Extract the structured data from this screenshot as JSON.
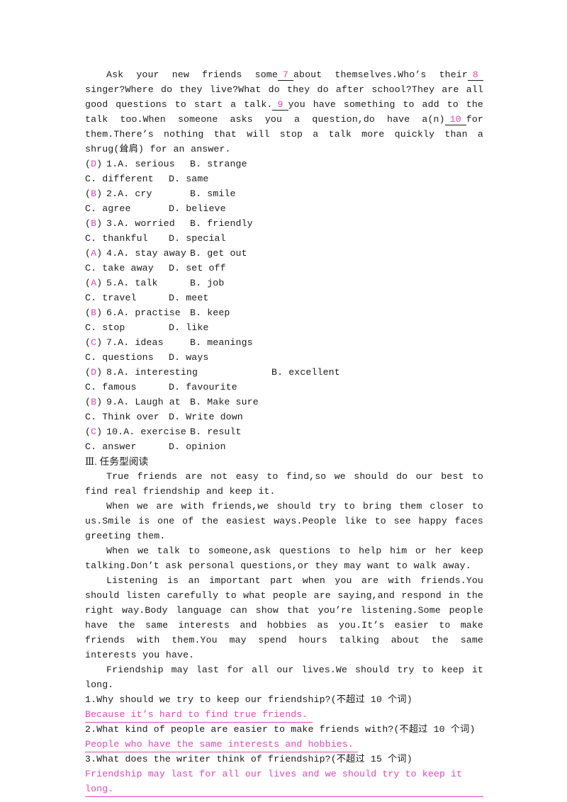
{
  "cloze": {
    "paragraph_parts": [
      "Ask your new friends some",
      "about themselves.Who’s their",
      "singer?Where do they live?What do they do after school?They are all good questions to start a talk.",
      "you have something to add to the talk too.When someone asks you a question,do have a(n)",
      "for them.There’s nothing that will stop a talk more quickly than a shrug(耸肩) for an answer."
    ],
    "blank_7": "7",
    "blank_8": "8",
    "blank_9": "9",
    "blank_10": "10"
  },
  "questions": [
    {
      "number": "1.",
      "answer": "D",
      "a": "A. serious",
      "b": "B. strange",
      "c": "C. different",
      "d": "D. same",
      "wide": false
    },
    {
      "number": "2.",
      "answer": "B",
      "a": "A. cry",
      "b": "B. smile",
      "c": "C. agree",
      "d": "D. believe",
      "wide": false
    },
    {
      "number": "3.",
      "answer": "B",
      "a": "A. worried",
      "b": "B. friendly",
      "c": "C. thankful",
      "d": "D. special",
      "wide": false
    },
    {
      "number": "4.",
      "answer": "A",
      "a": "A. stay away",
      "b": "B. get out",
      "c": "C. take away",
      "d": "D. set off",
      "wide": false
    },
    {
      "number": "5.",
      "answer": "A",
      "a": "A. talk",
      "b": "B. job",
      "c": "C. travel",
      "d": "D. meet",
      "wide": false
    },
    {
      "number": "6.",
      "answer": "B",
      "a": "A. practise",
      "b": "B. keep",
      "c": "C. stop",
      "d": "D. like",
      "wide": false
    },
    {
      "number": "7.",
      "answer": "C",
      "a": "A. ideas",
      "b": "B. meanings",
      "c": "C. questions",
      "d": "D. ways",
      "wide": false
    },
    {
      "number": "8.",
      "answer": "D",
      "a": "A. interesting",
      "b": "B. excellent",
      "c": "C. famous",
      "d": "D. favourite",
      "wide": true
    },
    {
      "number": "9.",
      "answer": "B",
      "a": "A. Laugh at",
      "b": "B. Make sure",
      "c": "C. Think over",
      "d": "D. Write down",
      "wide": false
    },
    {
      "number": "10.",
      "answer": "C",
      "a": "A. exercise",
      "b": "B. result",
      "c": "C. answer",
      "d": "D. opinion",
      "wide": false
    }
  ],
  "section": {
    "heading": "Ⅲ. 任务型阅读"
  },
  "passage": {
    "p1": "True friends are not easy to find,so we should do our best to find real friendship and keep it.",
    "p2": "When we are with friends,we should try to bring them closer to us.Smile is one of the easiest ways.People like to see happy faces greeting them.",
    "p3": "When we talk to someone,ask questions to help him or her keep talking.Don’t ask personal questions,or they may want to walk away.",
    "p4": "Listening is an important part when you are with friends.You should listen carefully to what people are saying,and respond in the right way.Body language can show that you’re listening.Some people have the same interests and hobbies as you.It’s easier to make friends with them.You may spend hours talking about the same interests you have.",
    "p5": "Friendship may last for all our lives.We should try to keep it long."
  },
  "reading_questions": [
    {
      "question": "1.Why should we try to keep our friendship?(不超过 10 个词)",
      "answer": "Because it’s hard to find true friends."
    },
    {
      "question": "2.What kind of people are easier to make friends with?(不超过 10 个词)",
      "answer": "People who have the same interests and hobbies."
    },
    {
      "question": "3.What does the writer think of friendship?(不超过 15 个词)",
      "answer": "Friendship may last for all our lives and we should try to keep it long."
    }
  ],
  "colors": {
    "answer_magenta": "#e246bb",
    "body_black": "#1a1a1a"
  }
}
